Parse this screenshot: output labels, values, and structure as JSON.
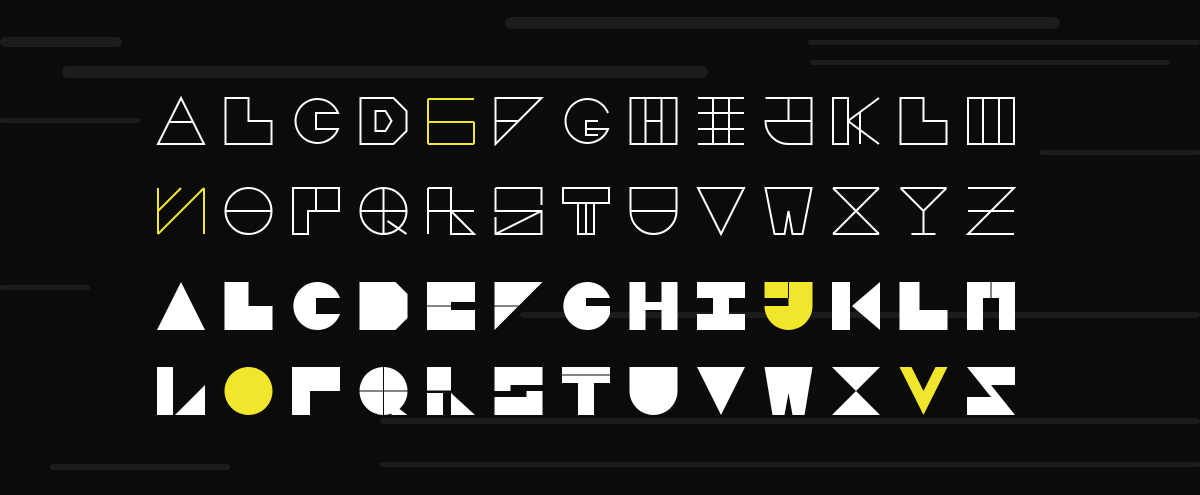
{
  "colors": {
    "background": "#0b0b0b",
    "streak": "#1c1c1c",
    "glyph": "#ffffff",
    "accent": "#f2e62d"
  },
  "alphabets": {
    "outline_style": {
      "rows": [
        [
          "A",
          "B",
          "C",
          "D",
          "E",
          "F",
          "G",
          "H",
          "I",
          "J",
          "K",
          "L",
          "M"
        ],
        [
          "N",
          "O",
          "P",
          "Q",
          "R",
          "S",
          "T",
          "U",
          "V",
          "W",
          "X",
          "Y",
          "Z"
        ]
      ],
      "highlighted": [
        "E",
        "N"
      ]
    },
    "solid_style": {
      "rows": [
        [
          "A",
          "B",
          "C",
          "D",
          "E",
          "F",
          "G",
          "H",
          "I",
          "J",
          "K",
          "L",
          "M"
        ],
        [
          "N",
          "O",
          "P",
          "Q",
          "R",
          "S",
          "T",
          "U",
          "V",
          "W",
          "X",
          "Y",
          "Z"
        ]
      ],
      "highlighted": [
        "J",
        "O",
        "Y"
      ]
    }
  }
}
